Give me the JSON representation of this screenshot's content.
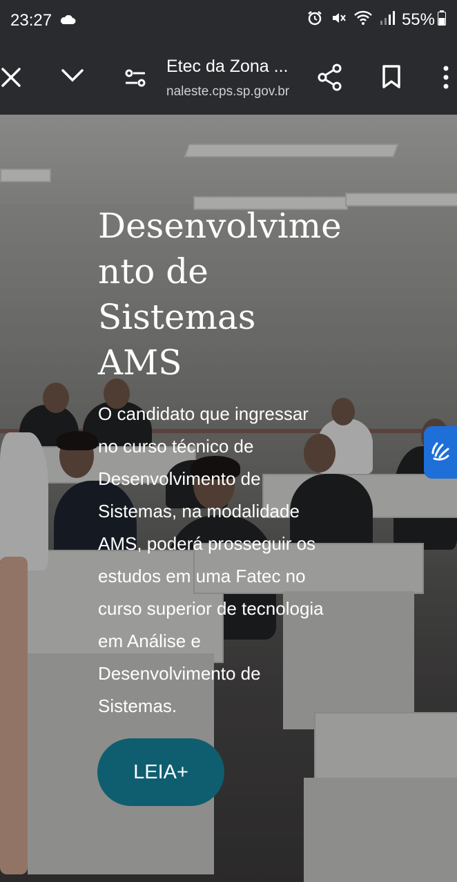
{
  "status_bar": {
    "time": "23:27",
    "battery": "55%",
    "icons": [
      "cloud-icon",
      "alarm-icon",
      "mute-icon",
      "wifi-icon",
      "signal-icon",
      "battery-icon"
    ]
  },
  "toolbar": {
    "title": "Etec da Zona ...",
    "url": "naleste.cps.sp.gov.br",
    "icons": [
      "close-icon",
      "chevron-down-icon",
      "page-settings-icon",
      "share-icon",
      "bookmark-icon",
      "more-icon"
    ]
  },
  "hero": {
    "title": "Desenvolvime\nnto de\nSistemas\nAMS",
    "description": "O candidato que ingressar\nno curso técnico de\nDesenvolvimento de\nSistemas, na modalidade\nAMS, poderá prosseguir os\nestudos em uma Fatec no\ncurso superior de tecnologia\nem Análise e\nDesenvolvimento de\nSistemas.",
    "button_label": "LEIA+"
  },
  "colors": {
    "toolbar_bg": "#2a2b2e",
    "button_bg": "#0f5e70",
    "accessibility_bg": "#1e6fd8"
  }
}
